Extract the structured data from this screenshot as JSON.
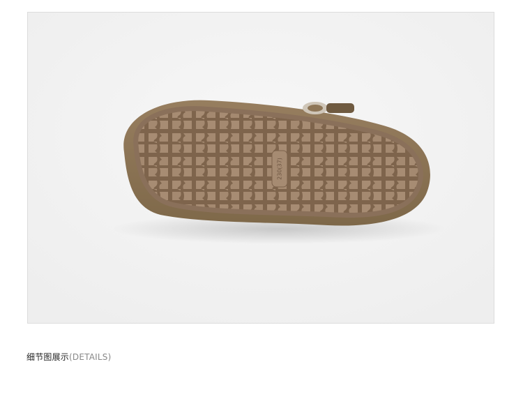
{
  "caption": {
    "title": "细节图展示",
    "subtitle": "(DETAILS)"
  },
  "photo": {
    "subject": "shoe-sole",
    "sole_marking": "230(37)",
    "colors": {
      "background": "#f4f4f4",
      "suede": "#8e7657",
      "suede_dark": "#6f5a40",
      "sole": "#9a8068",
      "sole_groove": "#7c624b",
      "sole_tile": "#a88d74",
      "frame_border": "#dcdcdc"
    }
  }
}
